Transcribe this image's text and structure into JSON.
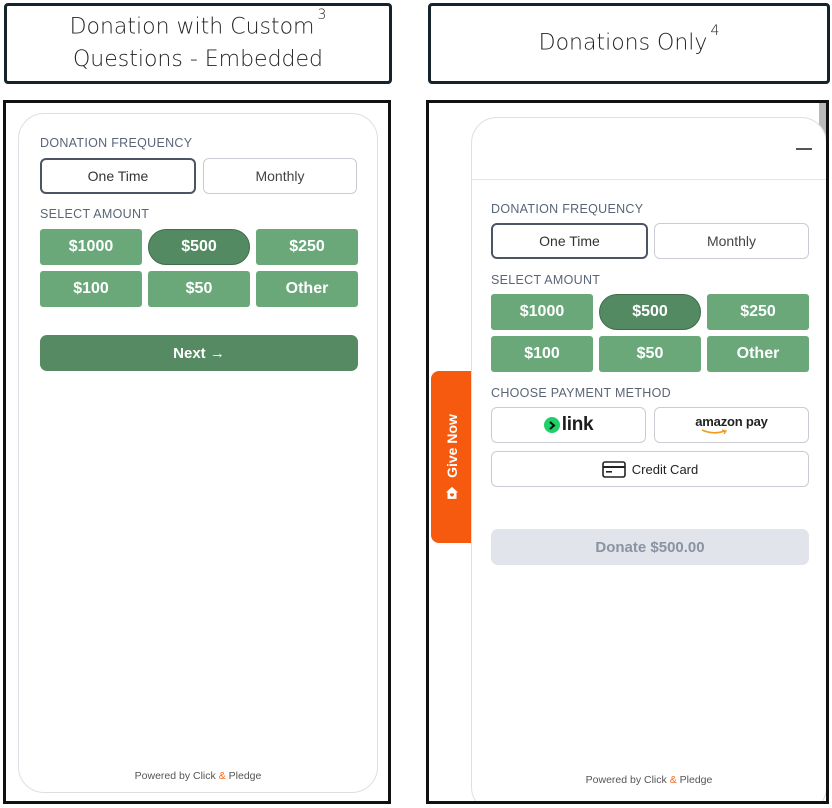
{
  "headers": {
    "left": {
      "line1": "Donation with Custom",
      "line2": "Questions - Embedded",
      "footnote": "3"
    },
    "right": {
      "line1": "Donations Only",
      "footnote": "4"
    }
  },
  "left_form": {
    "frequency_label": "DONATION FREQUENCY",
    "frequency_options": [
      "One Time",
      "Monthly"
    ],
    "amount_label": "SELECT AMOUNT",
    "amounts": [
      "$1000",
      "$500",
      "$250",
      "$100",
      "$50",
      "Other"
    ],
    "next_label": "Next →",
    "powered_prefix": "Powered by Click",
    "powered_amp": "&",
    "powered_suffix": "Pledge"
  },
  "right_form": {
    "frequency_label": "DONATION FREQUENCY",
    "frequency_options": [
      "One Time",
      "Monthly"
    ],
    "amount_label": "SELECT AMOUNT",
    "amounts": [
      "$1000",
      "$500",
      "$250",
      "$100",
      "$50",
      "Other"
    ],
    "payment_label": "CHOOSE PAYMENT METHOD",
    "payment_methods": {
      "link": "link",
      "amazon": "amazon pay",
      "card": "Credit Card"
    },
    "donate_label": "Donate $500.00",
    "give_tab_label": "Give Now",
    "powered_prefix": "Powered by Click",
    "powered_amp": "&",
    "powered_suffix": "Pledge"
  },
  "selected": {
    "frequency": "One Time",
    "amount": "$500"
  },
  "colors": {
    "amount_green": "#6aa87a",
    "selected_green": "#548a62",
    "give_orange": "#f55a0f",
    "link_green": "#1fcf6a"
  },
  "icons": [
    "minimize-icon",
    "link-logo-icon",
    "amazon-smile-icon",
    "credit-card-icon",
    "home-heart-icon"
  ]
}
